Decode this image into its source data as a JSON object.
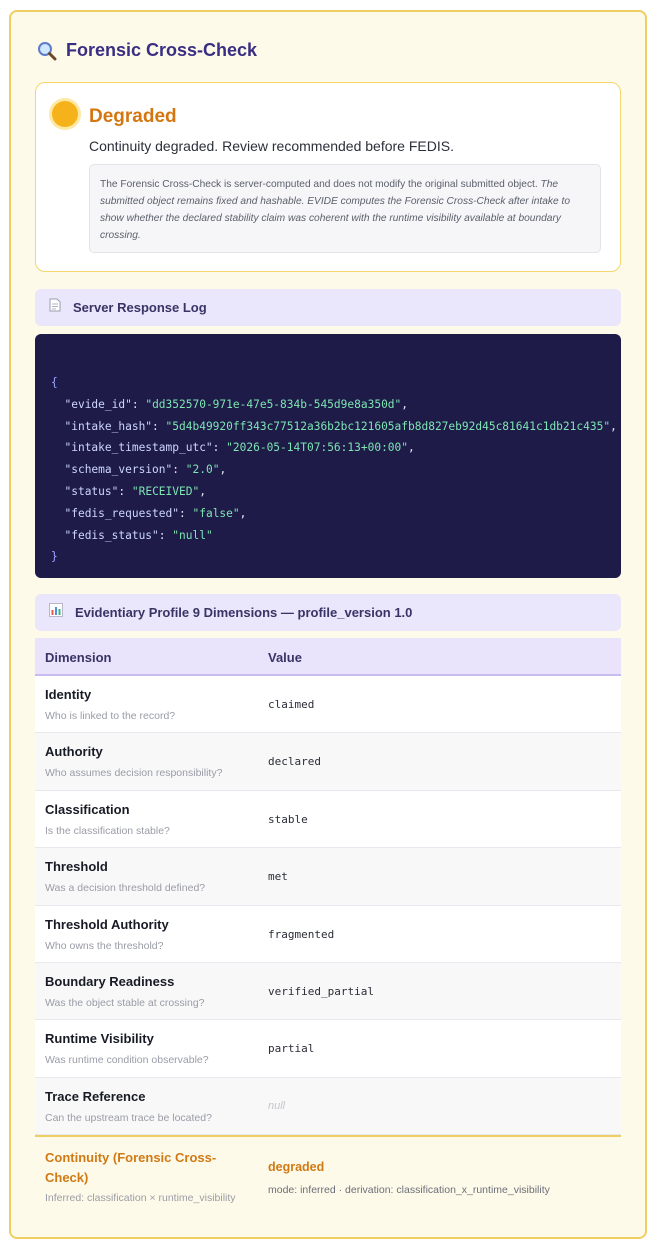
{
  "header": {
    "title": "Forensic Cross-Check",
    "icon": "magnifier-icon"
  },
  "status": {
    "label": "Degraded",
    "color": "#f6b21a",
    "summary": "Continuity degraded. Review recommended before FEDIS.",
    "note_line1": "The Forensic Cross-Check is server-computed and does not modify the original submitted object.",
    "note_rest": "The submitted object remains fixed and hashable. EVIDE computes the Forensic Cross-Check after intake to show whether the declared stability claim was coherent with the runtime visibility available at boundary crossing."
  },
  "server_log": {
    "title": "Server Response Log",
    "icon": "document-icon",
    "lines": [
      {
        "key": "\"evide_id\"",
        "value": "\"dd352570-971e-47e5-834b-545d9e8a350d\""
      },
      {
        "key": "\"intake_hash\"",
        "value": "\"5d4b49920ff343c77512a36b2bc121605afb8d827eb92d45c81641c1db21c435\""
      },
      {
        "key": "\"intake_timestamp_utc\"",
        "value": "\"2026-05-14T07:56:13+00:00\""
      },
      {
        "key": "\"schema_version\"",
        "value": "\"2.0\""
      },
      {
        "key": "\"status\"",
        "value": "\"RECEIVED\""
      },
      {
        "key": "\"fedis_requested\"",
        "value": "\"false\""
      },
      {
        "key": "\"fedis_status\"",
        "value": "\"null\""
      }
    ]
  },
  "profile": {
    "title": "Evidentiary Profile 9 Dimensions — profile_version 1.0",
    "icon": "bar-chart-icon",
    "columns": [
      "Dimension",
      "Value"
    ],
    "rows": [
      {
        "name": "Identity",
        "question": "Who is linked to the record?",
        "value": "claimed"
      },
      {
        "name": "Authority",
        "question": "Who assumes decision responsibility?",
        "value": "declared"
      },
      {
        "name": "Classification",
        "question": "Is the classification stable?",
        "value": "stable"
      },
      {
        "name": "Threshold",
        "question": "Was a decision threshold defined?",
        "value": "met"
      },
      {
        "name": "Threshold Authority",
        "question": "Who owns the threshold?",
        "value": "fragmented"
      },
      {
        "name": "Boundary Readiness",
        "question": "Was the object stable at crossing?",
        "value": "verified_partial"
      },
      {
        "name": "Runtime Visibility",
        "question": "Was runtime condition observable?",
        "value": "partial"
      },
      {
        "name": "Trace Reference",
        "question": "Can the upstream trace be located?",
        "value": "null"
      }
    ],
    "continuity": {
      "name": "Continuity (Forensic Cross-Check)",
      "inferred": "Inferred: classification × runtime_visibility",
      "value": "degraded",
      "mode": "mode: inferred · derivation: classification_x_runtime_visibility"
    }
  }
}
